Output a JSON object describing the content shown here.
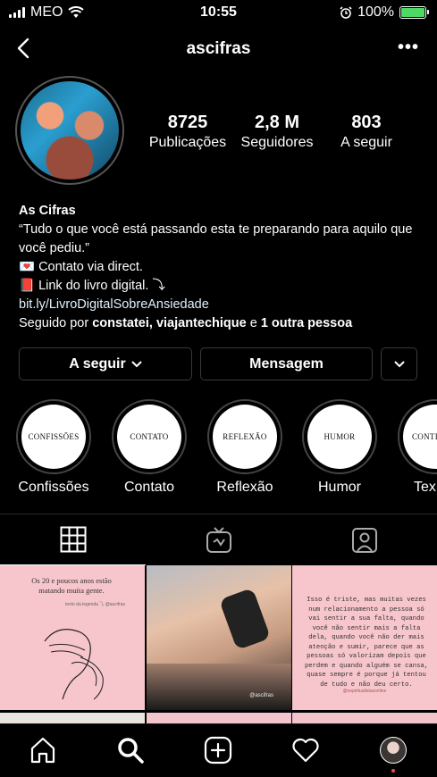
{
  "status_bar": {
    "carrier": "MEO",
    "time": "10:55",
    "battery": "100%",
    "battery_color": "#4cd964"
  },
  "nav": {
    "username": "ascifras",
    "back_icon": "chevron-left-icon",
    "more_icon": "more-horizontal-icon"
  },
  "profile": {
    "stats": [
      {
        "value": "8725",
        "label": "Publicações"
      },
      {
        "value": "2,8 M",
        "label": "Seguidores"
      },
      {
        "value": "803",
        "label": "A seguir"
      }
    ],
    "name": "As Cifras",
    "bio_line1": "“Tudo o que você está passando esta te preparando para aquilo que",
    "bio_line2": "você pediu.”",
    "bio_line3": "💌 Contato via direct.",
    "bio_line4": "📕 Link do livro digital. ⤵",
    "link": "bit.ly/LivroDigitalSobreAnsiedade",
    "followed_prefix": "Seguido por ",
    "followed_names": "constatei, viajantechique",
    "followed_and": " e ",
    "followed_others": "1 outra pessoa"
  },
  "buttons": {
    "following": "A seguir",
    "message": "Mensagem"
  },
  "highlights": [
    {
      "cover": "CONFISSÕES",
      "label": "Confissões"
    },
    {
      "cover": "CONTATO",
      "label": "Contato"
    },
    {
      "cover": "REFLEXÃO",
      "label": "Reflexão"
    },
    {
      "cover": "HUMOR",
      "label": "Humor"
    },
    {
      "cover": "CONTIN",
      "label": "Tex"
    }
  ],
  "tabs": [
    "grid-icon",
    "igtv-icon",
    "tagged-icon"
  ],
  "posts": {
    "post1_text": "Os 20 e poucos anos estão matando muita gente.",
    "post1_sub": "texto da legenda ⤵ @ascifras",
    "post2_watermark": "@ascifras",
    "post3_text": "Isso é triste, mas muitas vezes num relacionamento a pessoa só vai sentir a sua falta, quando você não sentir mais a falta dela, quando você não der mais atenção e sumir, parece que as pessoas só valorizam depois que perdem e quando alguém se cansa, quase sempre é porque já tentou de tudo e não deu certo.",
    "post3_sub": "@espiritualistasonline"
  },
  "bottom_nav": [
    "home-icon",
    "search-icon",
    "new-post-icon",
    "activity-icon",
    "profile-avatar"
  ]
}
